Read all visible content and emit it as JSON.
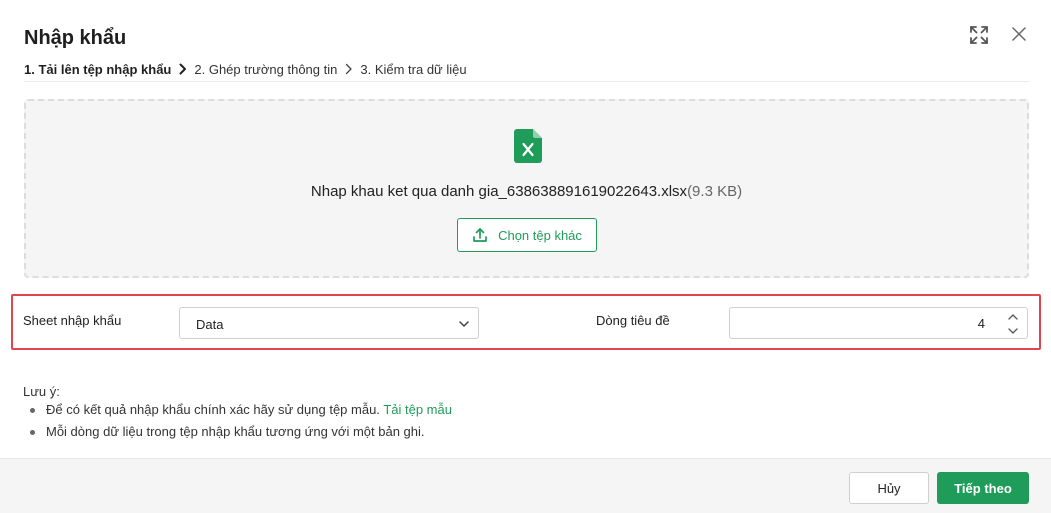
{
  "dialog": {
    "title": "Nhập khẩu",
    "expand_icon": "expand-icon",
    "close_icon": "close-icon"
  },
  "steps": [
    {
      "label": "1. Tải lên tệp nhập khẩu",
      "active": true
    },
    {
      "label": "2. Ghép trường thông tin",
      "active": false
    },
    {
      "label": "3. Kiểm tra dữ liệu",
      "active": false
    }
  ],
  "upload": {
    "file_icon": "excel-file-icon",
    "file_name": "Nhap khau ket qua danh gia_638638891619022643.xlsx",
    "file_size": "(9.3 KB)",
    "choose_label": "Chọn tệp khác",
    "choose_icon": "upload-icon"
  },
  "settings": {
    "sheet_label": "Sheet nhập khẩu",
    "sheet_value": "Data",
    "header_row_label": "Dòng tiêu đề",
    "header_row_value": "4"
  },
  "notes": {
    "title": "Lưu ý:",
    "item1_text": "Để có kết quả nhập khẩu chính xác hãy sử dụng tệp mẫu.",
    "item1_link": "Tải tệp mẫu",
    "item2_text": "Mỗi dòng dữ liệu trong tệp nhập khẩu tương ứng với một bản ghi."
  },
  "footer": {
    "cancel_label": "Hủy",
    "next_label": "Tiếp theo"
  },
  "colors": {
    "accent": "#1f9c59",
    "highlight": "#e0464e"
  }
}
